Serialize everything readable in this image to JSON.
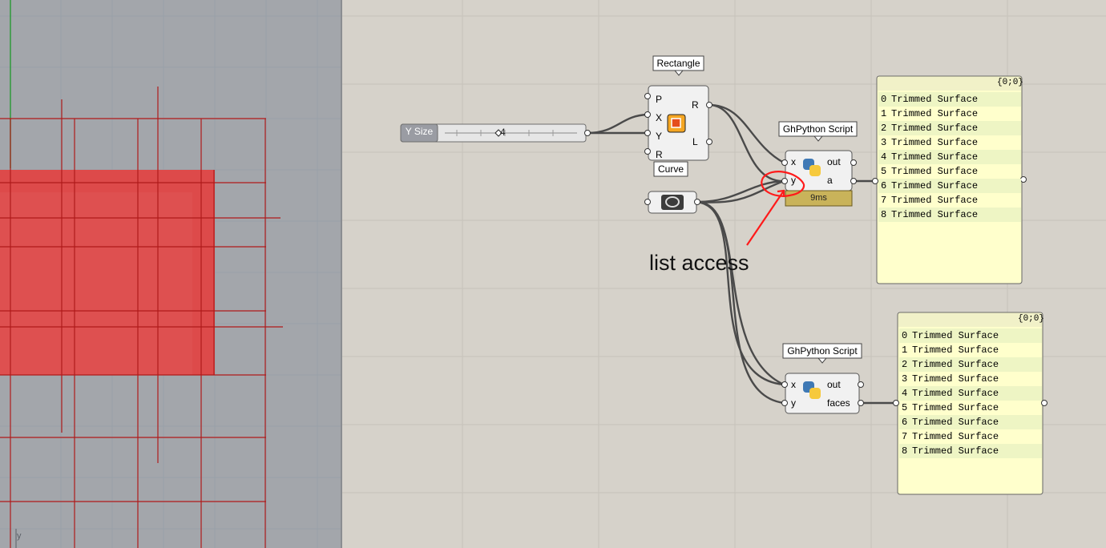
{
  "viewport": {
    "axis_label": "y"
  },
  "slider": {
    "label": "Y Size",
    "value": "4"
  },
  "rectangle": {
    "tooltip": "Rectangle",
    "inputs": [
      "P",
      "X",
      "Y",
      "R"
    ],
    "outputs": [
      "R",
      "L"
    ]
  },
  "curve": {
    "tooltip": "Curve"
  },
  "script1": {
    "tooltip": "GhPython Script",
    "inputs": [
      "x",
      "y"
    ],
    "outputs": [
      "out",
      "a"
    ],
    "timing": "9ms"
  },
  "script2": {
    "tooltip": "GhPython Script",
    "inputs": [
      "x",
      "y"
    ],
    "outputs": [
      "out",
      "faces"
    ]
  },
  "annotation": {
    "text": "list access"
  },
  "panel1": {
    "path": "{0;0}",
    "items": [
      {
        "i": "0",
        "v": "Trimmed Surface"
      },
      {
        "i": "1",
        "v": "Trimmed Surface"
      },
      {
        "i": "2",
        "v": "Trimmed Surface"
      },
      {
        "i": "3",
        "v": "Trimmed Surface"
      },
      {
        "i": "4",
        "v": "Trimmed Surface"
      },
      {
        "i": "5",
        "v": "Trimmed Surface"
      },
      {
        "i": "6",
        "v": "Trimmed Surface"
      },
      {
        "i": "7",
        "v": "Trimmed Surface"
      },
      {
        "i": "8",
        "v": "Trimmed Surface"
      }
    ]
  },
  "panel2": {
    "path": "{0;0}",
    "items": [
      {
        "i": "0",
        "v": "Trimmed Surface"
      },
      {
        "i": "1",
        "v": "Trimmed Surface"
      },
      {
        "i": "2",
        "v": "Trimmed Surface"
      },
      {
        "i": "3",
        "v": "Trimmed Surface"
      },
      {
        "i": "4",
        "v": "Trimmed Surface"
      },
      {
        "i": "5",
        "v": "Trimmed Surface"
      },
      {
        "i": "6",
        "v": "Trimmed Surface"
      },
      {
        "i": "7",
        "v": "Trimmed Surface"
      },
      {
        "i": "8",
        "v": "Trimmed Surface"
      }
    ]
  },
  "colors": {
    "surface": "#dd4a4a",
    "curve": "#b01b1b",
    "annotation": "#ff1a1a",
    "panel": "#ffffcc"
  }
}
